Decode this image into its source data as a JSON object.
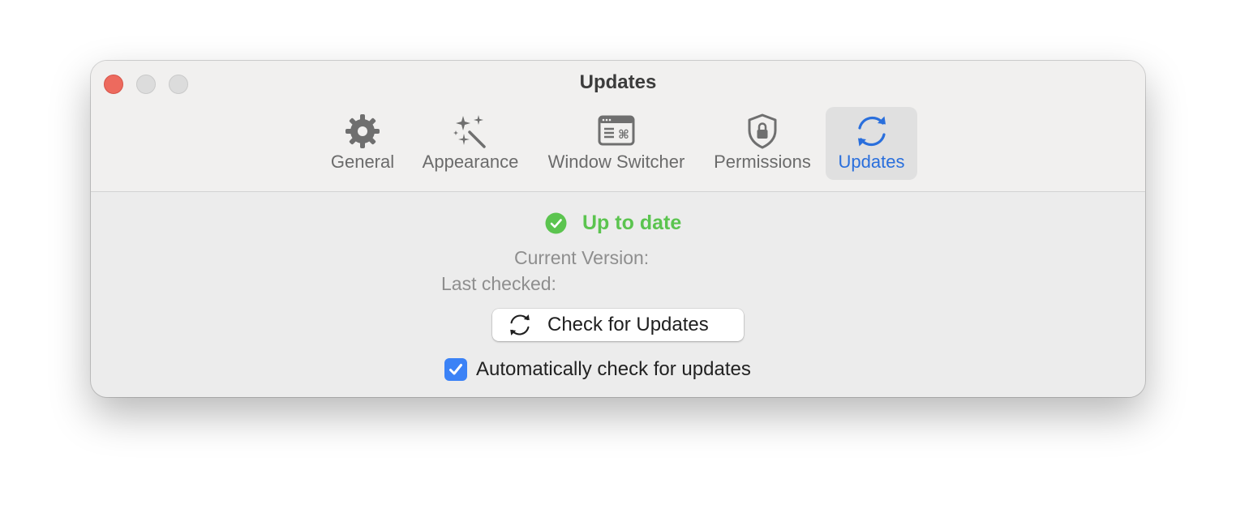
{
  "window": {
    "title": "Updates"
  },
  "toolbar": {
    "tabs": [
      {
        "label": "General",
        "icon": "gear-icon",
        "selected": false
      },
      {
        "label": "Appearance",
        "icon": "magic-wand-icon",
        "selected": false
      },
      {
        "label": "Window Switcher",
        "icon": "window-switcher-icon",
        "selected": false
      },
      {
        "label": "Permissions",
        "icon": "shield-lock-icon",
        "selected": false
      },
      {
        "label": "Updates",
        "icon": "sync-icon",
        "selected": true
      }
    ]
  },
  "status": {
    "text": "Up to date",
    "icon": "checkmark-circle-icon",
    "color": "#5bc44f"
  },
  "info": {
    "current_version_label": "Current Version:",
    "last_checked_label": "Last checked:"
  },
  "check_button": {
    "label": "Check for Updates",
    "icon": "sync-icon"
  },
  "auto_check": {
    "label": "Automatically check for updates",
    "checked": true
  },
  "colors": {
    "accent": "#2a6fdc",
    "checkbox": "#3b82f6",
    "close_button": "#ed6a5e"
  }
}
